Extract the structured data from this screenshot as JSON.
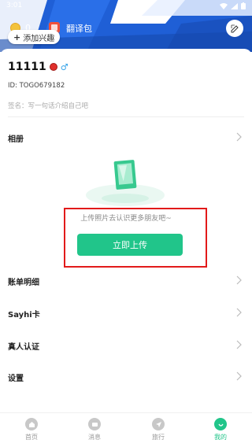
{
  "status_bar": {
    "time": "3:01"
  },
  "header": {
    "coin_count": "0",
    "translation_pack_label": "翻译包",
    "add_interest_label": "添加兴趣"
  },
  "profile": {
    "username": "11111",
    "gender_symbol": "♂",
    "id_text": "ID:  TOGO679182",
    "signature_placeholder": "签名：写一句话介绍自己吧"
  },
  "album": {
    "title": "相册",
    "empty_text": "上传照片去认识更多朋友吧~",
    "upload_button": "立即上传"
  },
  "menu": [
    {
      "label": "账单明细"
    },
    {
      "label": "Sayhi卡"
    },
    {
      "label": "真人认证"
    },
    {
      "label": "设置"
    }
  ],
  "bottom_nav": [
    {
      "label": "首页",
      "active": false
    },
    {
      "label": "消息",
      "active": false
    },
    {
      "label": "旅行",
      "active": false
    },
    {
      "label": "我的",
      "active": true
    }
  ],
  "colors": {
    "accent": "#21c58a",
    "header": "#2060d8",
    "highlight_frame": "#e21a1a"
  }
}
